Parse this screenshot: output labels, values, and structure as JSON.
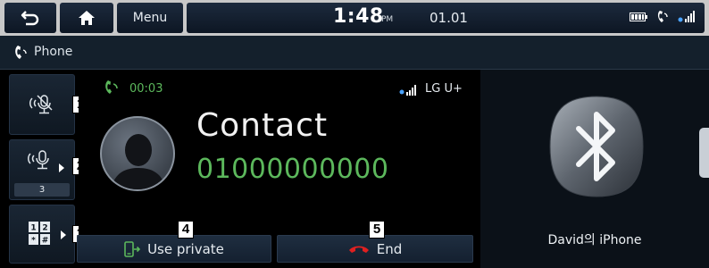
{
  "topbar": {
    "menu_label": "Menu",
    "time": "1:48",
    "ampm": "PM",
    "date": "01.01"
  },
  "header": {
    "title": "Phone"
  },
  "side_buttons": {
    "mute_count": "3"
  },
  "callouts": [
    "1",
    "2",
    "3",
    "4",
    "5"
  ],
  "call": {
    "duration": "00:03",
    "carrier": "LG U+",
    "contact_name": "Contact",
    "contact_number": "01000000000"
  },
  "actions": {
    "use_private_label": "Use private",
    "end_label": "End"
  },
  "device": {
    "name": "David의 iPhone"
  },
  "colors": {
    "accent_green": "#5cb85c",
    "end_red": "#e02020",
    "panel_dark": "#14202c"
  }
}
